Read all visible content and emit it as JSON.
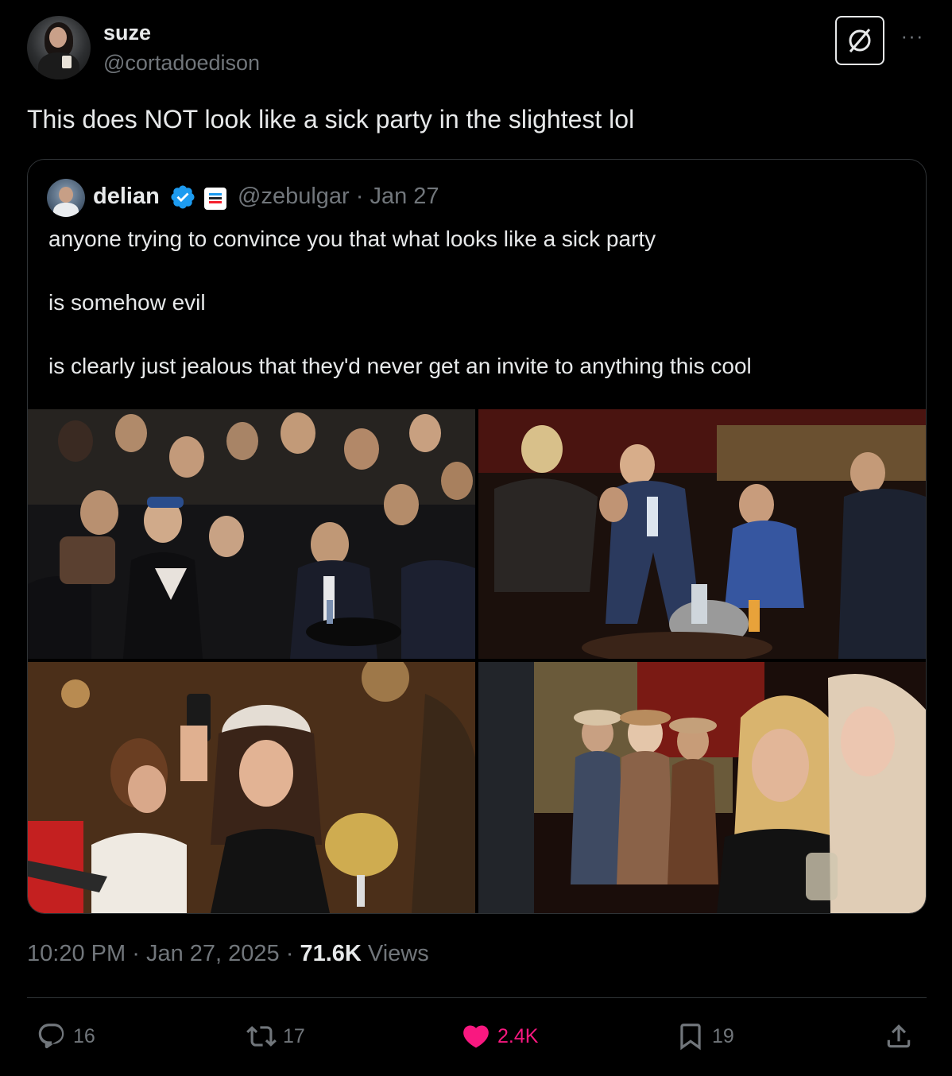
{
  "tweet": {
    "author_name": "suze",
    "author_handle": "@cortadoedison",
    "text": "This does NOT look like a sick party in the slightest lol",
    "time": "10:20 PM",
    "date": "Jan 27, 2025",
    "views_count": "71.6K",
    "views_label": "Views",
    "sep": "·"
  },
  "quoted": {
    "author_name": "delian",
    "meta": "@zebulgar · Jan 27",
    "lines": [
      "anyone trying to convince you that what looks like a sick party",
      "is somehow evil",
      "is clearly just jealous that they'd never get an invite to anything this cool"
    ]
  },
  "actions": {
    "replies": "16",
    "reposts": "17",
    "likes": "2.4K",
    "bookmarks": "19"
  },
  "icons": {
    "header": [
      "grok-icon",
      "more-icon"
    ],
    "quote": [
      "verified-badge-icon",
      "affiliate-badge-icon"
    ],
    "actions": [
      "reply-icon",
      "repost-icon",
      "like-icon",
      "bookmark-icon",
      "share-icon"
    ]
  },
  "colors": {
    "background": "#000000",
    "text": "#e7e9ea",
    "secondary": "#71767b",
    "border": "#2f3336",
    "like": "#f91880",
    "verified": "#1d9bf0"
  }
}
